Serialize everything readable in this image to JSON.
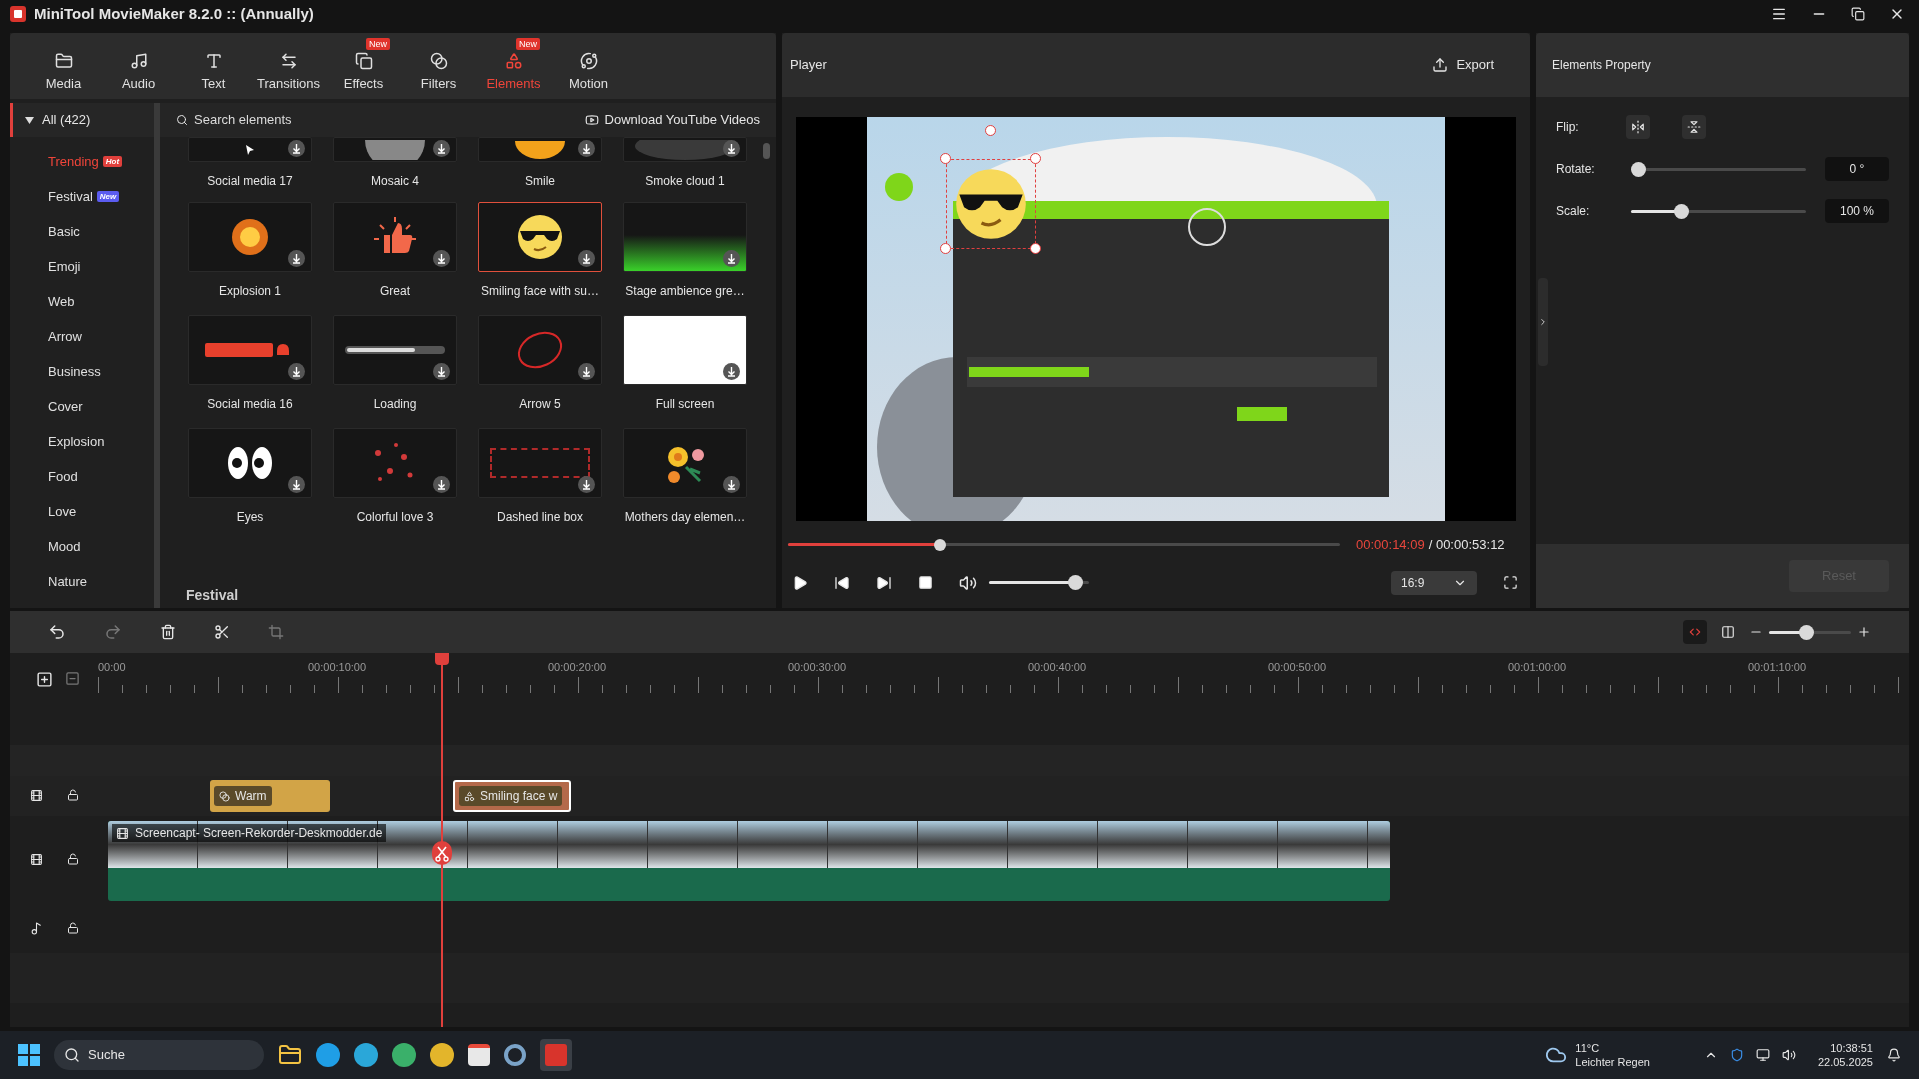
{
  "window": {
    "title": "MiniTool MovieMaker 8.2.0 :: (Annually)"
  },
  "tabs": [
    {
      "label": "Media",
      "selected": false
    },
    {
      "label": "Audio",
      "selected": false
    },
    {
      "label": "Text",
      "selected": false
    },
    {
      "label": "Transitions",
      "selected": false
    },
    {
      "label": "Effects",
      "selected": false,
      "badge": "New"
    },
    {
      "label": "Filters",
      "selected": false
    },
    {
      "label": "Elements",
      "selected": true,
      "badge": "New"
    },
    {
      "label": "Motion",
      "selected": false
    }
  ],
  "categories": {
    "all": {
      "label": "All (422)",
      "expanded": true
    },
    "items": [
      {
        "label": "Trending",
        "selected": true,
        "badge": "Hot",
        "color": "#e0403c"
      },
      {
        "label": "Festival",
        "selected": false,
        "badge": "New",
        "color": "#5b5cf0"
      },
      {
        "label": "Basic",
        "selected": false
      },
      {
        "label": "Emoji",
        "selected": false
      },
      {
        "label": "Web",
        "selected": false
      },
      {
        "label": "Arrow",
        "selected": false
      },
      {
        "label": "Business",
        "selected": false
      },
      {
        "label": "Cover",
        "selected": false
      },
      {
        "label": "Explosion",
        "selected": false
      },
      {
        "label": "Food",
        "selected": false
      },
      {
        "label": "Love",
        "selected": false
      },
      {
        "label": "Mood",
        "selected": false
      },
      {
        "label": "Nature",
        "selected": false
      }
    ]
  },
  "search": {
    "placeholder": "Search elements"
  },
  "download_link": "Download YouTube Videos",
  "elements": [
    {
      "label": "Social media 17",
      "kind": "cursor",
      "selected": false
    },
    {
      "label": "Mosaic 4",
      "kind": "mosaic",
      "selected": false
    },
    {
      "label": "Smile",
      "kind": "sun",
      "selected": false
    },
    {
      "label": "Smoke cloud 1",
      "kind": "smoke",
      "selected": false
    },
    {
      "label": "Explosion 1",
      "kind": "fire",
      "selected": false
    },
    {
      "label": "Great",
      "kind": "thumb",
      "selected": false
    },
    {
      "label": "Smiling face with su…",
      "kind": "emoji",
      "selected": true
    },
    {
      "label": "Stage ambience gre…",
      "kind": "glow",
      "selected": false
    },
    {
      "label": "Social media 16",
      "kind": "badge",
      "selected": false
    },
    {
      "label": "Loading",
      "kind": "bar",
      "selected": false
    },
    {
      "label": "Arrow 5",
      "kind": "circle",
      "selected": false
    },
    {
      "label": "Full screen",
      "kind": "white",
      "selected": false
    },
    {
      "label": "Eyes",
      "kind": "eyes",
      "selected": false
    },
    {
      "label": "Colorful love 3",
      "kind": "hearts",
      "selected": false
    },
    {
      "label": "Dashed line box",
      "kind": "dashed",
      "selected": false
    },
    {
      "label": "Mothers day elemen…",
      "kind": "flower",
      "selected": false
    }
  ],
  "section_title": "Festival",
  "player": {
    "title": "Player",
    "export": "Export",
    "progress": {
      "level": 0.27
    },
    "current_time": "00:00:14:09",
    "total_time": "/ 00:00:53:12",
    "volume": {
      "level": 0.93
    },
    "aspect": "16:9"
  },
  "properties": {
    "title": "Elements Property",
    "flip_label": "Flip:",
    "rotate": {
      "label": "Rotate:",
      "level": 0,
      "value": "0 °"
    },
    "scale": {
      "label": "Scale:",
      "level": 0.27,
      "value": "100 %"
    },
    "reset": {
      "label": "Reset",
      "disabled": true
    }
  },
  "timeline": {
    "zoom": {
      "level": 0.45
    },
    "ruler": [
      "00:00",
      "00:00:10:00",
      "00:00:20:00",
      "00:00:30:00",
      "00:00:40:00",
      "00:00:50:00",
      "00:01:00:00",
      "00:01:10:00"
    ],
    "clips": [
      {
        "label": "Warm",
        "kind": "filter",
        "selected": false
      },
      {
        "label": "Smiling face w",
        "kind": "element",
        "selected": true
      }
    ],
    "video_clip": {
      "label": "Screencapt- Screen-Rekorder-Deskmodder.de"
    }
  },
  "taskbar": {
    "search": "Suche",
    "weather": {
      "temp": "11°C",
      "text": "Leichter Regen"
    },
    "time": "10:38:51",
    "date": "22.05.2025"
  }
}
